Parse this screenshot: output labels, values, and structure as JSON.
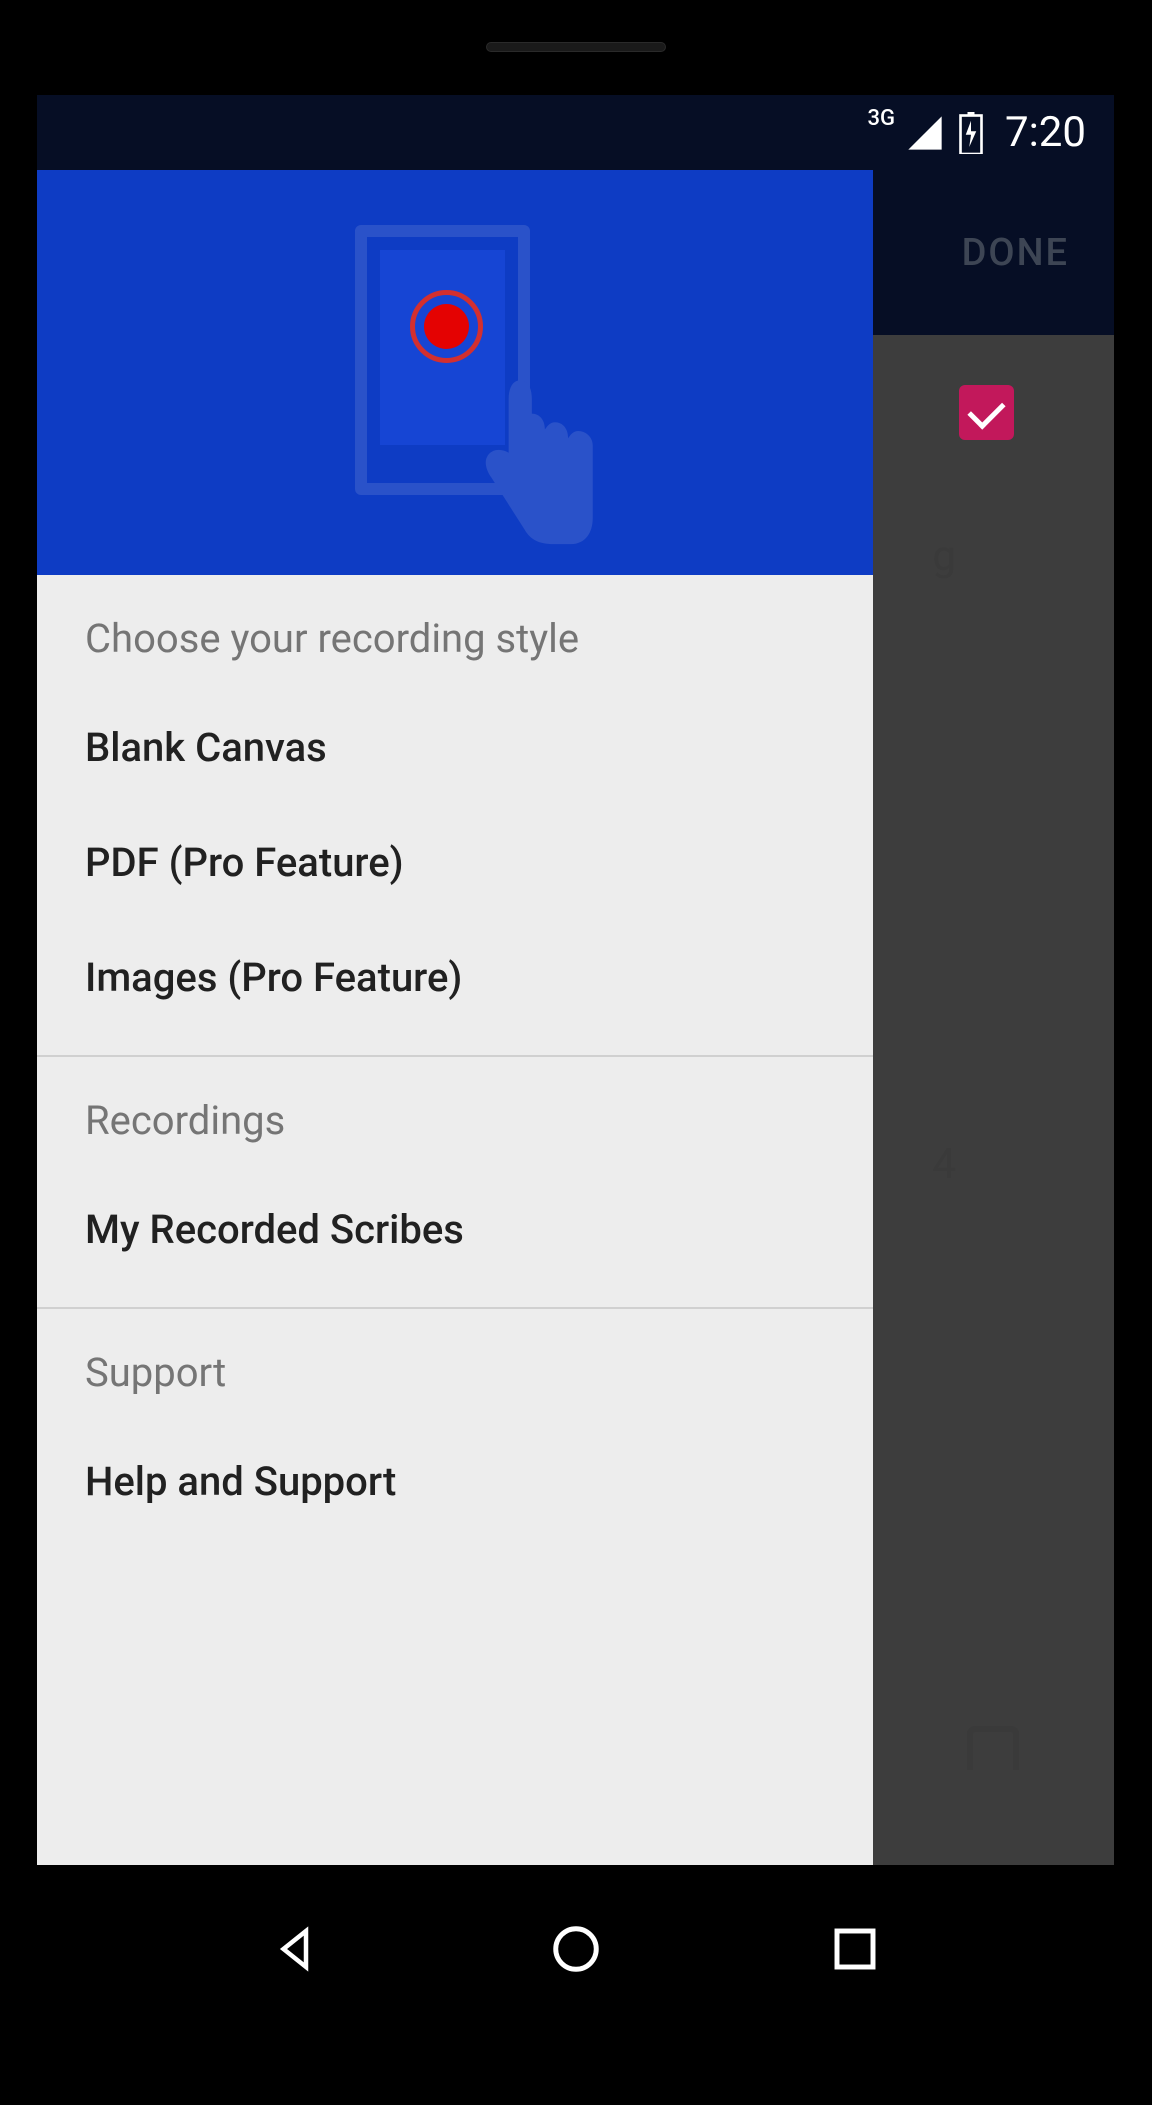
{
  "statusBar": {
    "network": "3G",
    "time": "7:20"
  },
  "toolbar": {
    "doneLabel": "DONE"
  },
  "backgroundVisible": {
    "text1": "g",
    "text2": "4"
  },
  "drawer": {
    "section1": {
      "title": "Choose your recording style",
      "items": [
        "Blank Canvas",
        "PDF (Pro Feature)",
        "Images (Pro Feature)"
      ]
    },
    "section2": {
      "title": "Recordings",
      "items": [
        "My Recorded Scribes"
      ]
    },
    "section3": {
      "title": "Support",
      "items": [
        "Help and Support"
      ]
    }
  }
}
